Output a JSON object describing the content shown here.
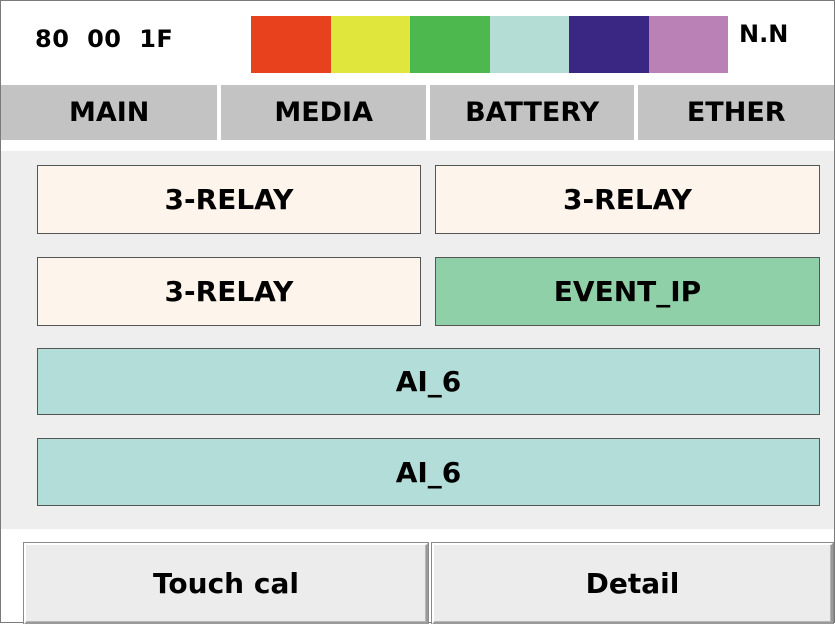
{
  "status": {
    "code": "80  00  1F",
    "indicator": "N.N",
    "colors": [
      "#e8411e",
      "#e0e63c",
      "#4cb84e",
      "#b4ddd6",
      "#3a2683",
      "#b981b6"
    ]
  },
  "tabs": [
    {
      "label": "MAIN"
    },
    {
      "label": "MEDIA"
    },
    {
      "label": "BATTERY"
    },
    {
      "label": "ETHER"
    }
  ],
  "tiles": {
    "relay_1": "3-RELAY",
    "relay_2": "3-RELAY",
    "relay_3": "3-RELAY",
    "event_ip": "EVENT_IP",
    "ai_1": "AI_6",
    "ai_2": "AI_6"
  },
  "buttons": {
    "touch_cal": "Touch cal",
    "detail": "Detail"
  }
}
